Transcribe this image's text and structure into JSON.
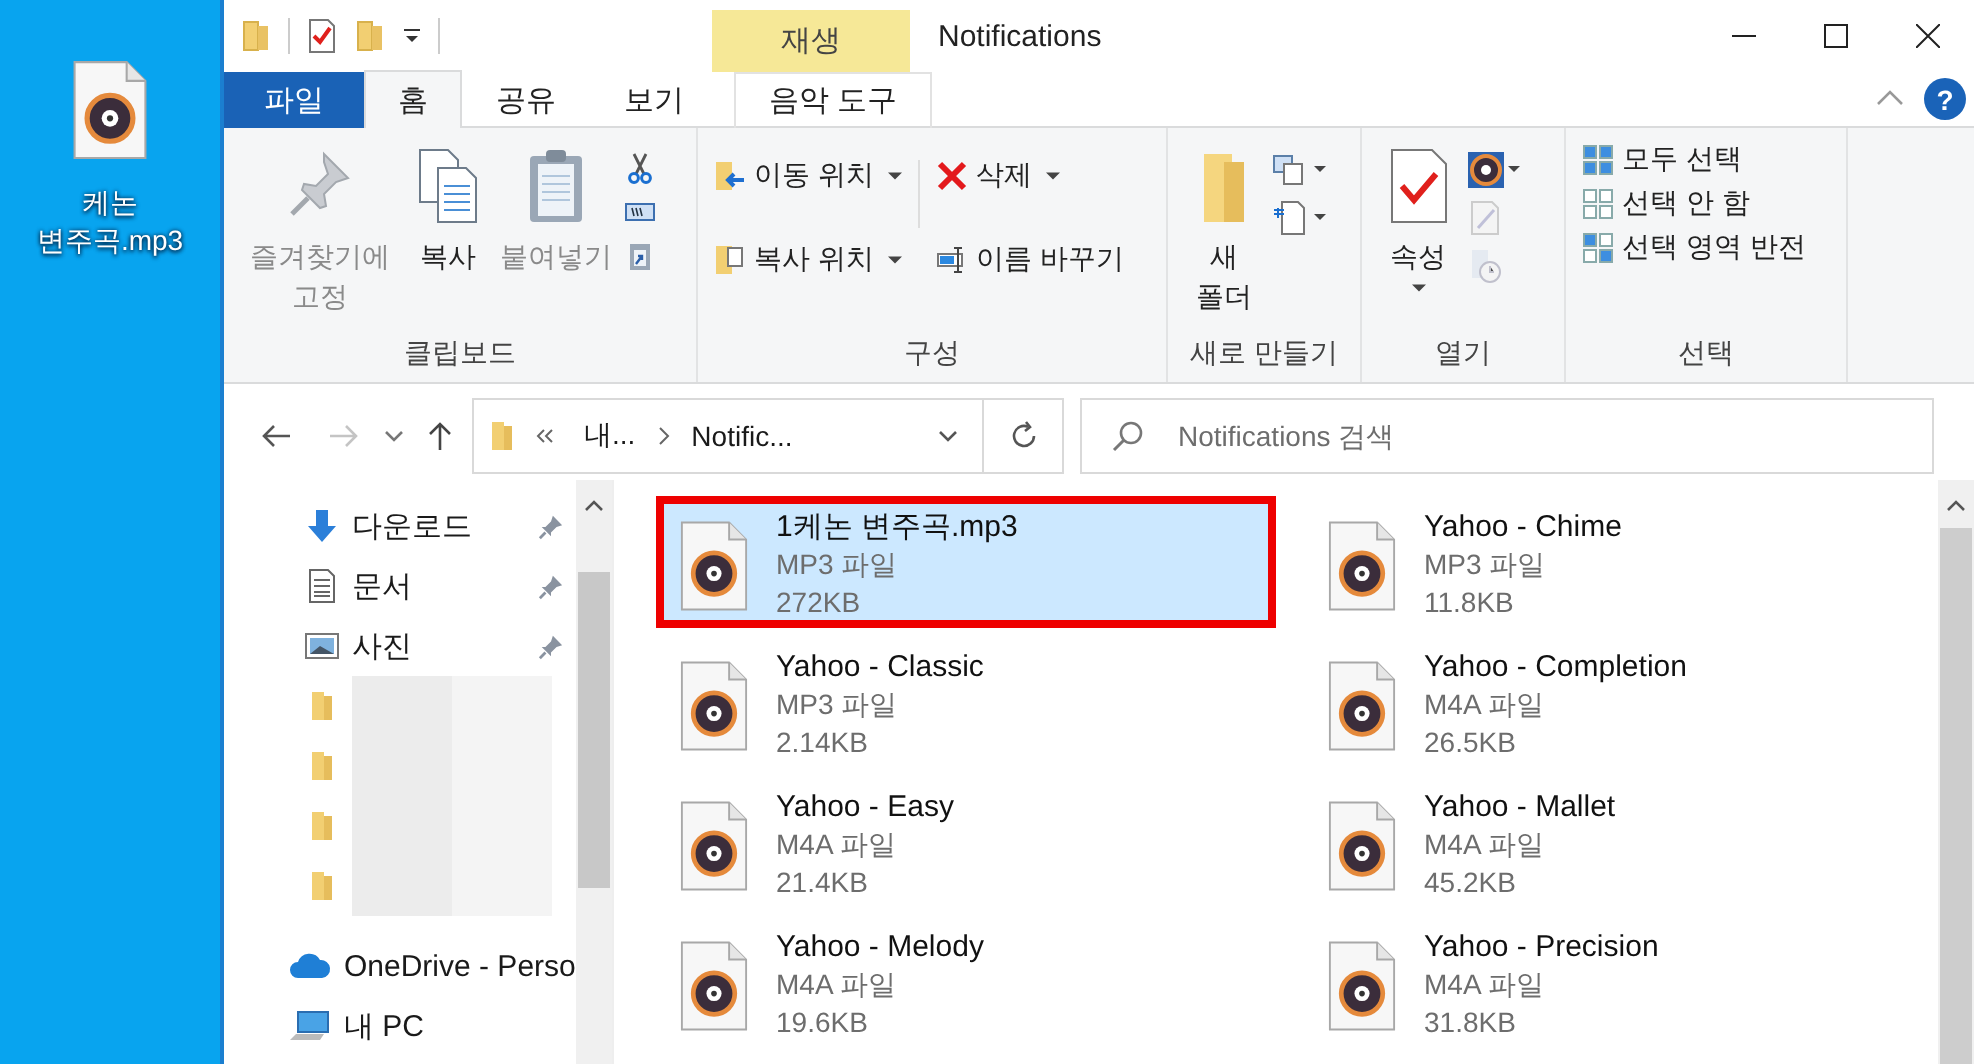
{
  "desktop": {
    "file_label": "케논 변주곡.mp3"
  },
  "window": {
    "title": "Notifications",
    "context_group": "재생",
    "help_label": "?"
  },
  "tabs": [
    {
      "label": "파일",
      "kind": "file",
      "selected": false
    },
    {
      "label": "홈",
      "kind": "normal",
      "selected": true
    },
    {
      "label": "공유",
      "kind": "normal",
      "selected": false
    },
    {
      "label": "보기",
      "kind": "normal",
      "selected": false
    },
    {
      "label": "음악 도구",
      "kind": "context",
      "selected": false
    }
  ],
  "ribbon": {
    "clipboard": {
      "label": "클립보드",
      "buttons": [
        {
          "label": "즐겨찾기에 고정",
          "disabled": true
        },
        {
          "label": "복사",
          "disabled": false
        },
        {
          "label": "붙여넣기",
          "disabled": true
        }
      ]
    },
    "organize": {
      "label": "구성",
      "buttons": [
        {
          "label": "이동 위치",
          "dropdown": true
        },
        {
          "label": "복사 위치",
          "dropdown": true
        },
        {
          "label": "삭제",
          "dropdown": true
        },
        {
          "label": "이름 바꾸기",
          "dropdown": false
        }
      ]
    },
    "new": {
      "label": "새로 만들기",
      "button": "새 폴더"
    },
    "open": {
      "label": "열기",
      "button": "속성"
    },
    "select": {
      "label": "선택",
      "buttons": [
        "모두 선택",
        "선택 안 함",
        "선택 영역 반전"
      ]
    }
  },
  "address": {
    "breadcrumbs": [
      "내...",
      "Notific..."
    ],
    "search_placeholder": "Notifications 검색"
  },
  "nav": {
    "items": [
      {
        "kind": "downloads",
        "label": "다운로드",
        "pinned": true
      },
      {
        "kind": "documents",
        "label": "문서",
        "pinned": true
      },
      {
        "kind": "pictures",
        "label": "사진",
        "pinned": true
      },
      {
        "kind": "folder",
        "pinned": false
      },
      {
        "kind": "folder",
        "pinned": false
      },
      {
        "kind": "folder",
        "pinned": false
      },
      {
        "kind": "folder",
        "pinned": false
      },
      {
        "kind": "onedrive",
        "label": "OneDrive - Perso",
        "pinned": false
      },
      {
        "kind": "pc",
        "label": "내 PC",
        "pinned": false
      }
    ]
  },
  "files": [
    {
      "name": "1케논 변주곡.mp3",
      "type": "MP3 파일",
      "size": "272KB",
      "selected": true,
      "outlined": true
    },
    {
      "name": "Yahoo - Chime",
      "type": "MP3 파일",
      "size": "11.8KB",
      "selected": false,
      "outlined": false
    },
    {
      "name": "Yahoo - Classic",
      "type": "MP3 파일",
      "size": "2.14KB",
      "selected": false,
      "outlined": false
    },
    {
      "name": "Yahoo - Completion",
      "type": "M4A 파일",
      "size": "26.5KB",
      "selected": false,
      "outlined": false
    },
    {
      "name": "Yahoo - Easy",
      "type": "M4A 파일",
      "size": "21.4KB",
      "selected": false,
      "outlined": false
    },
    {
      "name": "Yahoo - Mallet",
      "type": "M4A 파일",
      "size": "45.2KB",
      "selected": false,
      "outlined": false
    },
    {
      "name": "Yahoo - Melody",
      "type": "M4A 파일",
      "size": "19.6KB",
      "selected": false,
      "outlined": false
    },
    {
      "name": "Yahoo - Precision",
      "type": "M4A 파일",
      "size": "31.8KB",
      "selected": false,
      "outlined": false
    }
  ]
}
